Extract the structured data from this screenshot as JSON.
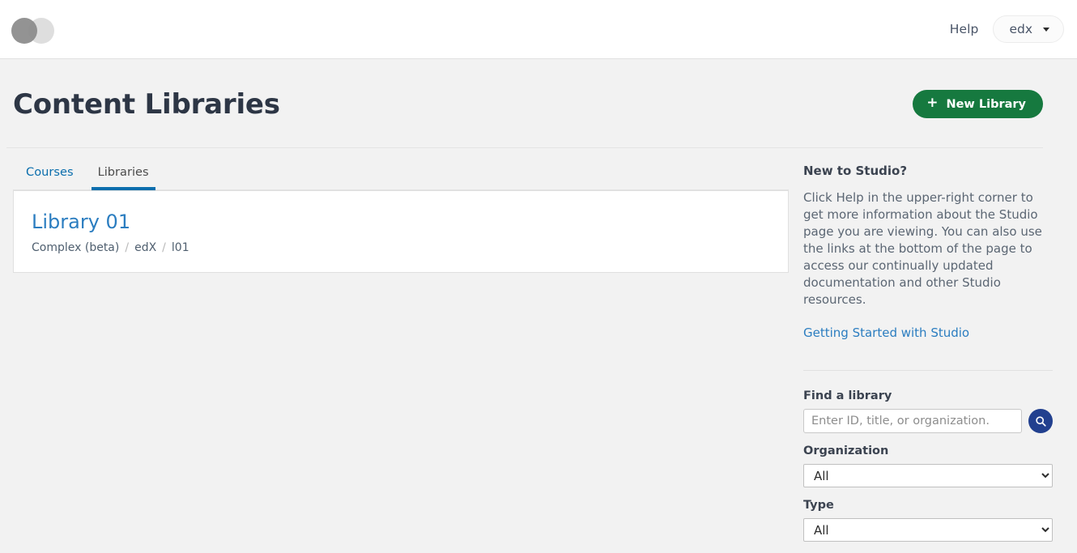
{
  "header": {
    "logo_name": "studio-logo",
    "help_label": "Help",
    "account_label": "edx"
  },
  "page": {
    "title": "Content Libraries",
    "new_library_button": "New Library",
    "new_library_icon": "plus-icon"
  },
  "tabs": [
    {
      "label": "Courses",
      "active": false
    },
    {
      "label": "Libraries",
      "active": true
    }
  ],
  "libraries": [
    {
      "title": "Library 01",
      "type": "Complex (beta)",
      "org": "edX",
      "number": "l01",
      "separator": "/"
    }
  ],
  "sidebar": {
    "heading": "New to Studio?",
    "body": "Click Help in the upper-right corner to get more information about the Studio page you are viewing. You can also use the links at the bottom of the page to access our continually updated documentation and other Studio resources.",
    "link": "Getting Started with Studio",
    "find_library_label": "Find a library",
    "search_placeholder": "Enter ID, title, or organization.",
    "search_value": "",
    "search_icon": "search-icon",
    "organization_label": "Organization",
    "organization_value": "All",
    "organization_options": [
      "All"
    ],
    "type_label": "Type",
    "type_value": "All",
    "type_options": [
      "All"
    ]
  },
  "colors": {
    "accent_blue": "#0a6ead",
    "link_blue": "#2b7dc0",
    "green": "#16793f",
    "search_navy": "#22408f",
    "page_bg": "#f2f2f2"
  }
}
